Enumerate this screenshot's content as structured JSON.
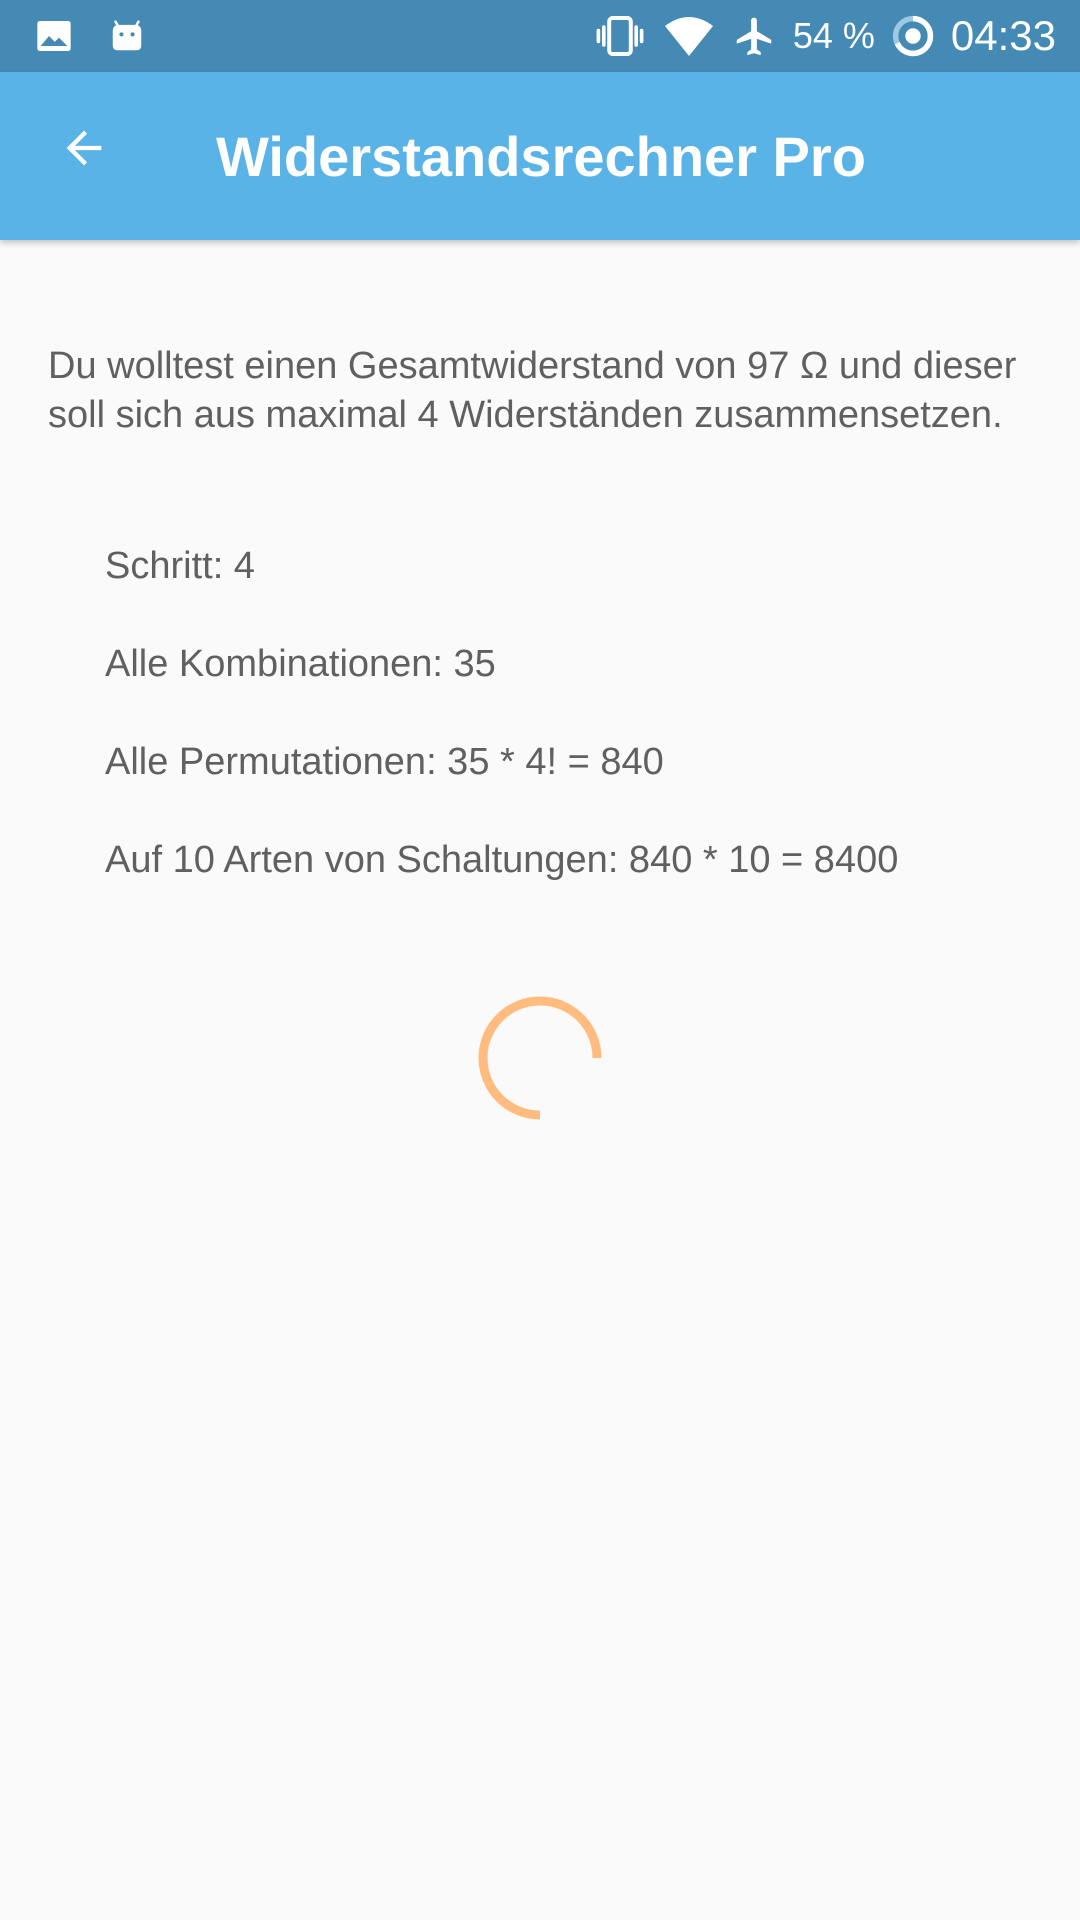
{
  "status_bar": {
    "battery_percent": "54 %",
    "time": "04:33",
    "icons": [
      "image-icon",
      "android-icon",
      "vibrate-icon",
      "wifi-icon",
      "airplane-icon",
      "battery-ring-icon"
    ],
    "background_color": "#448ab5"
  },
  "app_bar": {
    "title": "Widerstandsrechner Pro",
    "back_icon": "arrow-back-icon",
    "background_color": "#5ab3e6"
  },
  "main": {
    "intro": "Du wolltest einen Gesamtwiderstand von 97 Ω und dieser soll sich aus maximal 4 Widerständen zusammensetzen.",
    "stats": [
      "Schritt: 4",
      "Alle Kombinationen: 35",
      "Alle Permutationen: 35 * 4! = 840",
      "Auf 10 Arten von Schaltungen: 840 * 10 = 8400"
    ],
    "spinner_color": "#ffbc7e"
  }
}
